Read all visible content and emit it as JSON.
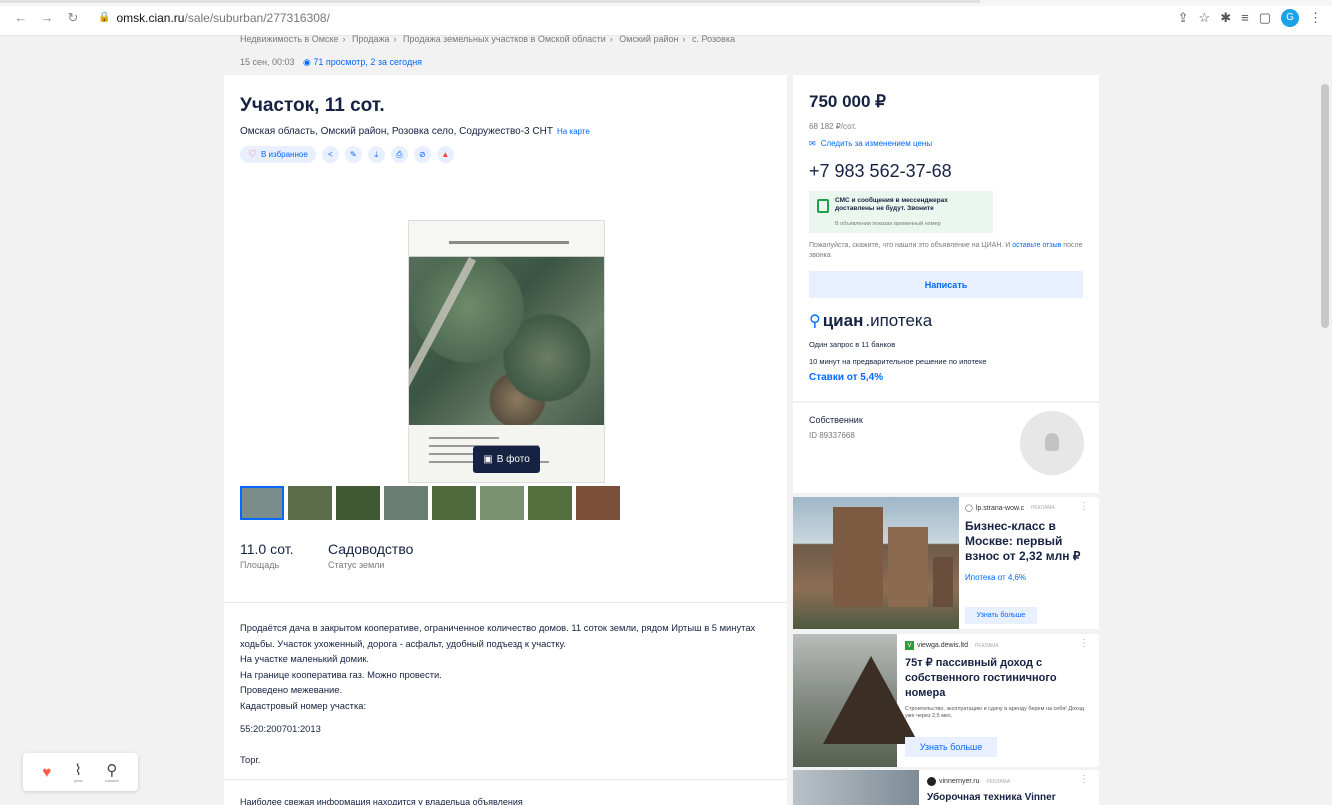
{
  "browser": {
    "url_host": "omsk.cian.ru",
    "url_path": "/sale/suburban/277316308/",
    "profile_letter": "G"
  },
  "breadcrumbs": [
    "Недвижимость в Омске",
    "Продажа",
    "Продажа земельных участков в Омской области",
    "Омский район",
    "с. Розовка"
  ],
  "meta": {
    "date": "15 сен, 00:03",
    "views": "71 просмотр, 2 за сегодня"
  },
  "listing": {
    "title": "Участок, 11 сот.",
    "address": "Омская область, Омский район, Розовка село, Содружество-3 СНТ",
    "map_link": "На карте",
    "favorite_label": "В избранное",
    "photo_button": "В фото",
    "params": [
      {
        "value": "11.0 сот.",
        "label": "Площадь"
      },
      {
        "value": "Садоводство",
        "label": "Статус земли"
      }
    ],
    "description": [
      "Продаётся дача в закрытом кооперативе, ограниченное количество домов. 11 соток земли, рядом Иртыш в 5 минутах ходьбы. Участок ухоженный, дорога - асфальт, удобный подъезд к участку.",
      "На участке маленький домик.",
      "На границе кооператива газ. Можно провести.",
      "Проведено межевание.",
      "Кадастровый номер участка:"
    ],
    "cadastral": "55:20:200701:2013",
    "torg": "Торг.",
    "more_info": "Наиболее свежая информация находится у владельца объявления"
  },
  "sidebar": {
    "price": "750 000 ₽",
    "price_per_unit": "68 182 ₽/сот.",
    "track_price": "Следить за изменением цены",
    "phone": "+7 983 562-37-68",
    "sms_title": "СМС и сообщения в мессенджерах доставлены не будут. Звоните",
    "sms_sub": "В объявлении показан временный номер",
    "note": "Пожалуйста, скажите, что нашли это объявление на ЦИАН. И ",
    "note_link": "оставьте отзыв",
    "note_tail": " после звонка",
    "write_button": "Написать",
    "ipoteka_brand_bold": "циан",
    "ipoteka_brand_rest": ".ипотека",
    "ipoteka_line1": "Один запрос в 11 банков",
    "ipoteka_line2": "10 минут на предварительное решение по ипотеке",
    "ipoteka_rate": "Ставки от 5,4%"
  },
  "owner": {
    "role": "Собственник",
    "id": "ID 89337668"
  },
  "ads": [
    {
      "source": "lp.strana-wow.c",
      "tag": "РЕКЛАМА",
      "headline": "Бизнес-класс в Москве: первый взнос от 2,32 млн ₽",
      "sub": "Ипотека от 4,6%",
      "cta": "Узнать больше"
    },
    {
      "source": "viewga.dewis.ltd",
      "tag": "РЕКЛАМА",
      "headline": "75т ₽ пассивный доход с собственного гостиничного номера",
      "sub": "Строительство, эксплуатацию и сдачу в аренду берем на себя! Доход уже через 2,5 мес.",
      "cta": "Узнать больше"
    },
    {
      "source": "vinnernyer.ru",
      "tag": "РЕКЛАМА",
      "headline": "Уборочная техника Vinner"
    }
  ],
  "float_widget": {
    "item2": "цены",
    "item3": "поиском"
  }
}
